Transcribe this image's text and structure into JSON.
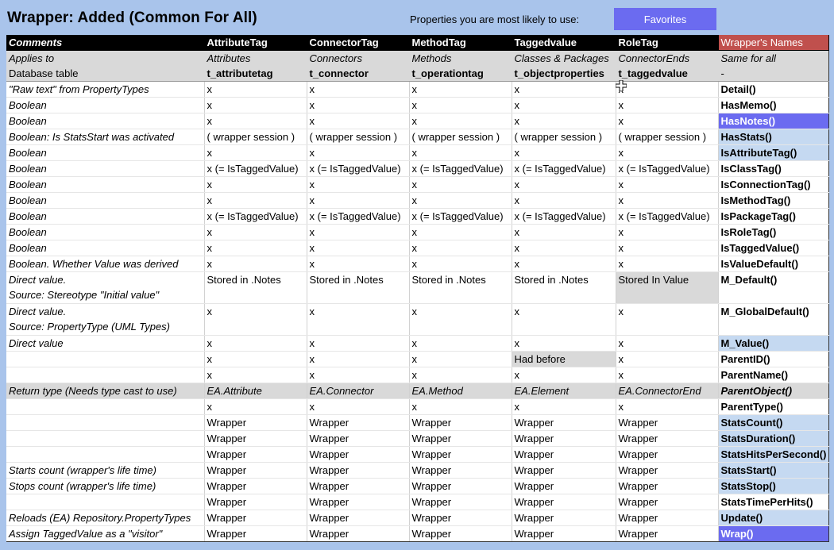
{
  "header": {
    "title": "Wrapper: Added (Common For All)",
    "prop_hint": "Properties you are most likely to use:",
    "favorites_label": "Favorites"
  },
  "columns": [
    "Comments",
    "AttributeTag",
    "ConnectorTag",
    "MethodTag",
    "Taggedvalue",
    "RoleTag",
    "Wrapper's Names"
  ],
  "meta_rows": [
    [
      "Applies to",
      "Attributes",
      "Connectors",
      "Methods",
      "Classes & Packages",
      "ConnectorEnds",
      "Same for all"
    ],
    [
      "Database table",
      "t_attributetag",
      "t_connector",
      "t_operationtag",
      "t_objectproperties",
      "t_taggedvalue",
      "-"
    ]
  ],
  "rows": [
    [
      "\"Raw text\" from PropertyTypes",
      "x",
      "x",
      "x",
      "x",
      "x",
      "Detail()"
    ],
    [
      "Boolean",
      "x",
      "x",
      "x",
      "x",
      "x",
      "HasMemo()"
    ],
    [
      "Boolean",
      "x",
      "x",
      "x",
      "x",
      "x",
      "HasNotes()"
    ],
    [
      "Boolean: Is StatsStart was activated",
      "( wrapper session )",
      "( wrapper session )",
      "( wrapper session )",
      "( wrapper session )",
      "( wrapper session )",
      "HasStats()"
    ],
    [
      "Boolean",
      "x",
      "x",
      "x",
      "x",
      "x",
      "IsAttributeTag()"
    ],
    [
      "Boolean",
      "x (= IsTaggedValue)",
      "x (= IsTaggedValue)",
      "x (= IsTaggedValue)",
      "x (= IsTaggedValue)",
      "x (= IsTaggedValue)",
      "IsClassTag()"
    ],
    [
      "Boolean",
      "x",
      "x",
      "x",
      "x",
      "x",
      "IsConnectionTag()"
    ],
    [
      "Boolean",
      "x",
      "x",
      "x",
      "x",
      "x",
      "IsMethodTag()"
    ],
    [
      "Boolean",
      "x (= IsTaggedValue)",
      "x (= IsTaggedValue)",
      "x (= IsTaggedValue)",
      "x (= IsTaggedValue)",
      "x (= IsTaggedValue)",
      "IsPackageTag()"
    ],
    [
      "Boolean",
      "x",
      "x",
      "x",
      "x",
      "x",
      "IsRoleTag()"
    ],
    [
      "Boolean",
      "x",
      "x",
      "x",
      "x",
      "x",
      "IsTaggedValue()"
    ],
    [
      "Boolean. Whether Value was derived",
      "x",
      "x",
      "x",
      "x",
      "x",
      "IsValueDefault()"
    ],
    [
      "Direct value.",
      "Stored in .Notes",
      "Stored in .Notes",
      "Stored in .Notes",
      "Stored in .Notes",
      "Stored In Value",
      "M_Default()",
      "Source: Stereotype \"Initial value\""
    ],
    [
      "Direct value.",
      "x",
      "x",
      "x",
      "x",
      "x",
      "M_GlobalDefault()",
      "Source: PropertyType (UML Types)"
    ],
    [
      "Direct value",
      "x",
      "x",
      "x",
      "x",
      "x",
      "M_Value()"
    ],
    [
      "",
      "x",
      "x",
      "x",
      "Had before",
      "x",
      "ParentID()"
    ],
    [
      "",
      "x",
      "x",
      "x",
      "x",
      "x",
      "ParentName()"
    ],
    [
      "Return type (Needs type cast to use)",
      "EA.Attribute",
      "EA.Connector",
      "EA.Method",
      "EA.Element",
      "EA.ConnectorEnd",
      "ParentObject()"
    ],
    [
      "",
      "x",
      "x",
      "x",
      "x",
      "x",
      "ParentType()"
    ],
    [
      "",
      "Wrapper",
      "Wrapper",
      "Wrapper",
      "Wrapper",
      "Wrapper",
      "StatsCount()"
    ],
    [
      "",
      "Wrapper",
      "Wrapper",
      "Wrapper",
      "Wrapper",
      "Wrapper",
      "StatsDuration()"
    ],
    [
      "",
      "Wrapper",
      "Wrapper",
      "Wrapper",
      "Wrapper",
      "Wrapper",
      "StatsHitsPerSecond()"
    ],
    [
      "Starts count (wrapper's life time)",
      "Wrapper",
      "Wrapper",
      "Wrapper",
      "Wrapper",
      "Wrapper",
      "StatsStart()"
    ],
    [
      "Stops count (wrapper's life time)",
      "Wrapper",
      "Wrapper",
      "Wrapper",
      "Wrapper",
      "Wrapper",
      "StatsStop()"
    ],
    [
      "",
      "Wrapper",
      "Wrapper",
      "Wrapper",
      "Wrapper",
      "Wrapper",
      "StatsTimePerHits()"
    ],
    [
      "Reloads (EA) Repository.PropertyTypes",
      "Wrapper",
      "Wrapper",
      "Wrapper",
      "Wrapper",
      "Wrapper",
      "Update()"
    ],
    [
      "Assign TaggedValue as a \"visitor\"",
      "Wrapper",
      "Wrapper",
      "Wrapper",
      "Wrapper",
      "Wrapper",
      "Wrap()"
    ]
  ],
  "colors": {
    "background": "#a9c4eb",
    "favorites_button": "#6b6bf0",
    "names_header": "#c0504d",
    "highlight_light": "#c5d9f1",
    "highlight_dark": "#6b6bf0",
    "gray_cell": "#d9d9d9"
  },
  "icons": [
    "cursor-icon"
  ]
}
